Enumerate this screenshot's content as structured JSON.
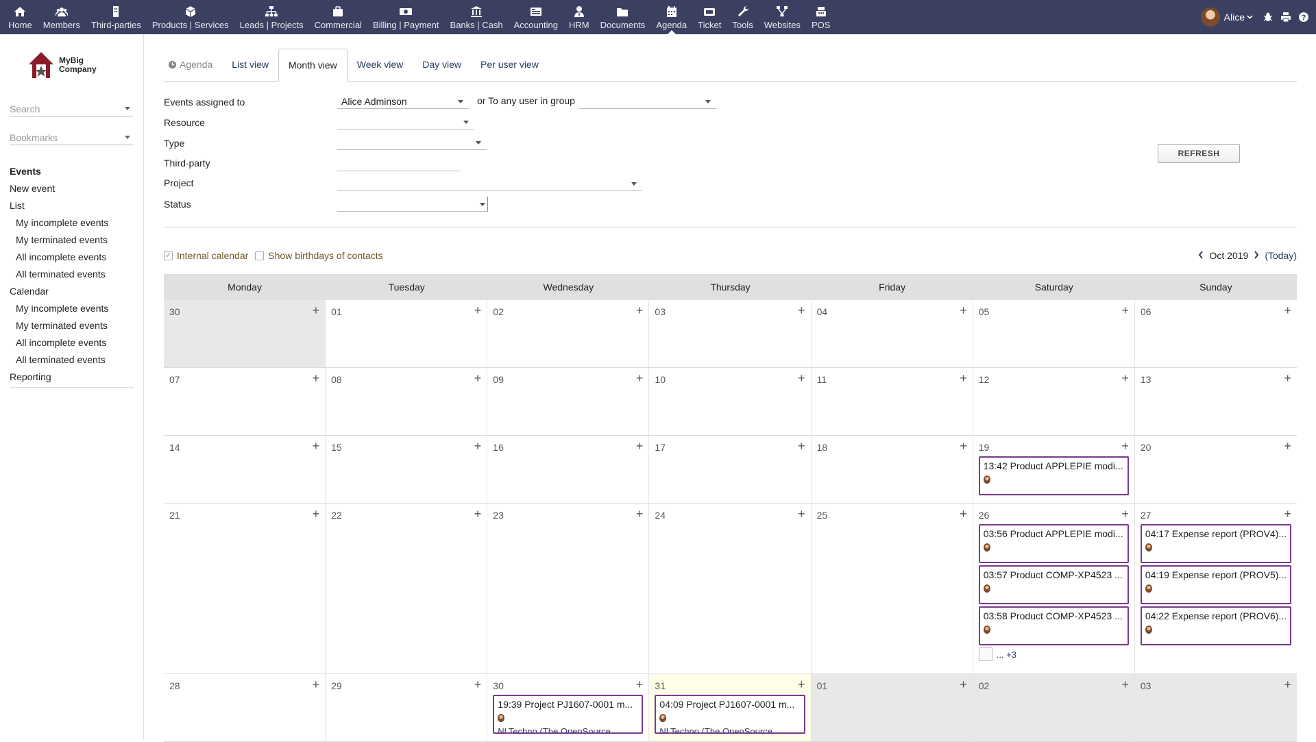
{
  "topmenu": [
    {
      "label": "Home",
      "icon": "home-icon"
    },
    {
      "label": "Members",
      "icon": "members-icon"
    },
    {
      "label": "Third-parties",
      "icon": "building-icon"
    },
    {
      "label": "Products | Services",
      "icon": "cube-icon"
    },
    {
      "label": "Leads | Projects",
      "icon": "sitemap-icon"
    },
    {
      "label": "Commercial",
      "icon": "briefcase-icon"
    },
    {
      "label": "Billing | Payment",
      "icon": "money-icon"
    },
    {
      "label": "Banks | Cash",
      "icon": "bank-icon"
    },
    {
      "label": "Accounting",
      "icon": "accounting-icon"
    },
    {
      "label": "HRM",
      "icon": "user-tie-icon"
    },
    {
      "label": "Documents",
      "icon": "folder-icon"
    },
    {
      "label": "Agenda",
      "icon": "calendar-icon"
    },
    {
      "label": "Ticket",
      "icon": "ticket-icon"
    },
    {
      "label": "Tools",
      "icon": "wrench-icon"
    },
    {
      "label": "Websites",
      "icon": "network-icon"
    },
    {
      "label": "POS",
      "icon": "cash-register-icon"
    }
  ],
  "active_menu": "Agenda",
  "user": {
    "name": "Alice"
  },
  "logo": {
    "line1": "MyBig",
    "line2": "Company"
  },
  "sidebar": {
    "search_placeholder": "Search",
    "bookmarks_placeholder": "Bookmarks",
    "menu": {
      "events": "Events",
      "new_event": "New event",
      "list": "List",
      "my_incomplete_events": "My incomplete events",
      "my_terminated_events": "My terminated events",
      "all_incomplete_events": "All incomplete events",
      "all_terminated_events": "All terminated events",
      "calendar": "Calendar",
      "cal_my_incomplete_events": "My incomplete events",
      "cal_my_terminated_events": "My terminated events",
      "cal_all_incomplete_events": "All incomplete events",
      "cal_all_terminated_events": "All terminated events",
      "reporting": "Reporting"
    }
  },
  "tabs": {
    "title": "Agenda",
    "list_view": "List view",
    "month_view": "Month view",
    "week_view": "Week view",
    "day_view": "Day view",
    "per_user_view": "Per user view"
  },
  "filters": {
    "events_assigned_to_label": "Events assigned to",
    "events_assigned_to_value": "Alice Adminson",
    "group_label": "or To any user in group",
    "resource_label": "Resource",
    "type_label": "Type",
    "thirdparty_label": "Third-party",
    "project_label": "Project",
    "status_label": "Status",
    "refresh_label": "REFRESH"
  },
  "options": {
    "internal_calendar": "Internal calendar",
    "show_birthdays": "Show birthdays of contacts"
  },
  "nav": {
    "month": "Oct 2019",
    "today": "(Today)"
  },
  "calendar": {
    "days_of_week": [
      "Monday",
      "Tuesday",
      "Wednesday",
      "Thursday",
      "Friday",
      "Saturday",
      "Sunday"
    ],
    "weeks": [
      [
        {
          "num": "30",
          "other": true
        },
        {
          "num": "01"
        },
        {
          "num": "02"
        },
        {
          "num": "03"
        },
        {
          "num": "04"
        },
        {
          "num": "05"
        },
        {
          "num": "06"
        }
      ],
      [
        {
          "num": "07"
        },
        {
          "num": "08"
        },
        {
          "num": "09"
        },
        {
          "num": "10"
        },
        {
          "num": "11"
        },
        {
          "num": "12"
        },
        {
          "num": "13"
        }
      ],
      [
        {
          "num": "14"
        },
        {
          "num": "15"
        },
        {
          "num": "16"
        },
        {
          "num": "17"
        },
        {
          "num": "18"
        },
        {
          "num": "19",
          "events": [
            {
              "text": "13:42 Product APPLEPIE modi..."
            }
          ]
        },
        {
          "num": "20"
        }
      ],
      [
        {
          "num": "21"
        },
        {
          "num": "22"
        },
        {
          "num": "23"
        },
        {
          "num": "24"
        },
        {
          "num": "25"
        },
        {
          "num": "26",
          "events": [
            {
              "text": "03:56 Product APPLEPIE modi..."
            },
            {
              "text": "03:57 Product COMP-XP4523 ..."
            },
            {
              "text": "03:58 Product COMP-XP4523 ..."
            }
          ],
          "more": "... +3"
        },
        {
          "num": "27",
          "events": [
            {
              "text": "04:17 Expense report (PROV4)..."
            },
            {
              "text": "04:19 Expense report (PROV5)..."
            },
            {
              "text": "04:22 Expense report (PROV6)..."
            }
          ]
        }
      ],
      [
        {
          "num": "28"
        },
        {
          "num": "29"
        },
        {
          "num": "30",
          "events": [
            {
              "text": "19:39 Project PJ1607-0001 m...",
              "thirdparty": "NLTechno (The OpenSource"
            }
          ]
        },
        {
          "num": "31",
          "today": true,
          "events": [
            {
              "text": "04:09 Project PJ1607-0001 m...",
              "thirdparty": "NLTechno (The OpenSource"
            }
          ]
        },
        {
          "num": "01",
          "other": true
        },
        {
          "num": "02",
          "other": true
        },
        {
          "num": "03",
          "other": true
        }
      ]
    ]
  },
  "colors": {
    "topbar": "#3c4060",
    "event_border": "#7a3a8a",
    "link": "#263c5c",
    "today_bg": "#fdfde8"
  }
}
